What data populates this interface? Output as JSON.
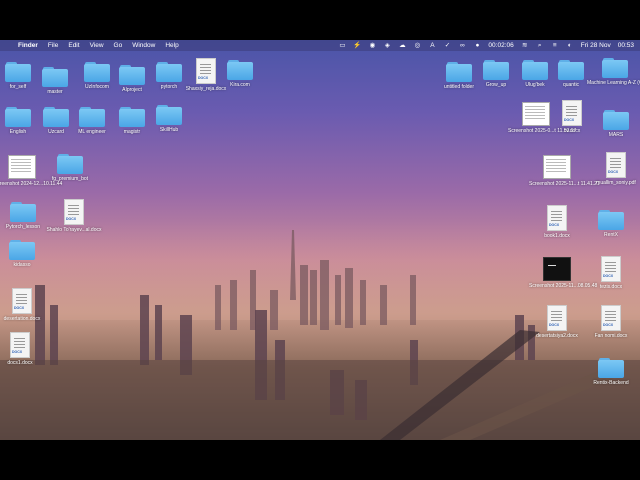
{
  "menubar": {
    "apple_glyph": "",
    "items": [
      "Finder",
      "File",
      "Edit",
      "View",
      "Go",
      "Window",
      "Help"
    ],
    "timer": "00:02:06",
    "date": "Fri 28 Nov",
    "time": "00:53",
    "status_icons": [
      "display-icon",
      "bolt-icon",
      "chat-icon",
      "layer-icon",
      "cloud-icon",
      "broadcast-icon",
      "keyboard-icon",
      "check-icon",
      "link-icon",
      "record-icon",
      "wifi-icon",
      "search-icon",
      "control-center-icon",
      "siri-icon"
    ]
  },
  "desktop": {
    "left_icons": [
      {
        "label": "for_self",
        "kind": "folder"
      },
      {
        "label": "master",
        "kind": "folder"
      },
      {
        "label": "UzInfocom",
        "kind": "folder"
      },
      {
        "label": "AIproject",
        "kind": "folder"
      },
      {
        "label": "pytorch",
        "kind": "folder"
      },
      {
        "label": "Shaxsiy_reja.docx",
        "kind": "doc"
      },
      {
        "label": "Kira.com",
        "kind": "folder"
      },
      {
        "label": "English",
        "kind": "folder"
      },
      {
        "label": "Uzcard",
        "kind": "folder"
      },
      {
        "label": "ML engineer",
        "kind": "folder"
      },
      {
        "label": "magistr",
        "kind": "folder"
      },
      {
        "label": "SkillHub",
        "kind": "folder"
      },
      {
        "label": "Screenshot 2024-12...10.11.44",
        "kind": "shot"
      },
      {
        "label": "fg_premium_bot",
        "kind": "folder"
      },
      {
        "label": "Pytorch_lesson",
        "kind": "folder"
      },
      {
        "label": "Shahlo To'rayev...al.docx",
        "kind": "doc"
      },
      {
        "label": "kidasso",
        "kind": "folder"
      },
      {
        "label": "desertation.docx",
        "kind": "doc"
      },
      {
        "label": "docs1.docx",
        "kind": "doc"
      }
    ],
    "right_icons": [
      {
        "label": "untitled folder",
        "kind": "folder"
      },
      {
        "label": "Grow_up",
        "kind": "folder"
      },
      {
        "label": "Ulug'bek",
        "kind": "folder"
      },
      {
        "label": "quantic",
        "kind": "folder"
      },
      {
        "label": "Machine Learning A-Z (Co...Datasets)",
        "kind": "folder"
      },
      {
        "label": "Screenshot 2025-0...t 11.53.17",
        "kind": "shot"
      },
      {
        "label": "cv.docx",
        "kind": "doc"
      },
      {
        "label": "MARS",
        "kind": "folder"
      },
      {
        "label": "Screenshot 2025-11...t 11.41.21",
        "kind": "shot"
      },
      {
        "label": "muallim_soniy.pdf",
        "kind": "doc"
      },
      {
        "label": "book1.docx",
        "kind": "doc"
      },
      {
        "label": "RentX",
        "kind": "folder"
      },
      {
        "label": "Screenshot 2025-11...08.05.48",
        "kind": "shot-dark"
      },
      {
        "label": "tezis.docx",
        "kind": "doc"
      },
      {
        "label": "desertatsiya2.docx",
        "kind": "doc"
      },
      {
        "label": "Fan nomi.docx",
        "kind": "doc"
      },
      {
        "label": "Rentix-Backend",
        "kind": "folder"
      }
    ]
  },
  "doc_tag": "DOCX",
  "colors": {
    "folder": "#5fb0e8",
    "menubar": "#3c3c78"
  }
}
